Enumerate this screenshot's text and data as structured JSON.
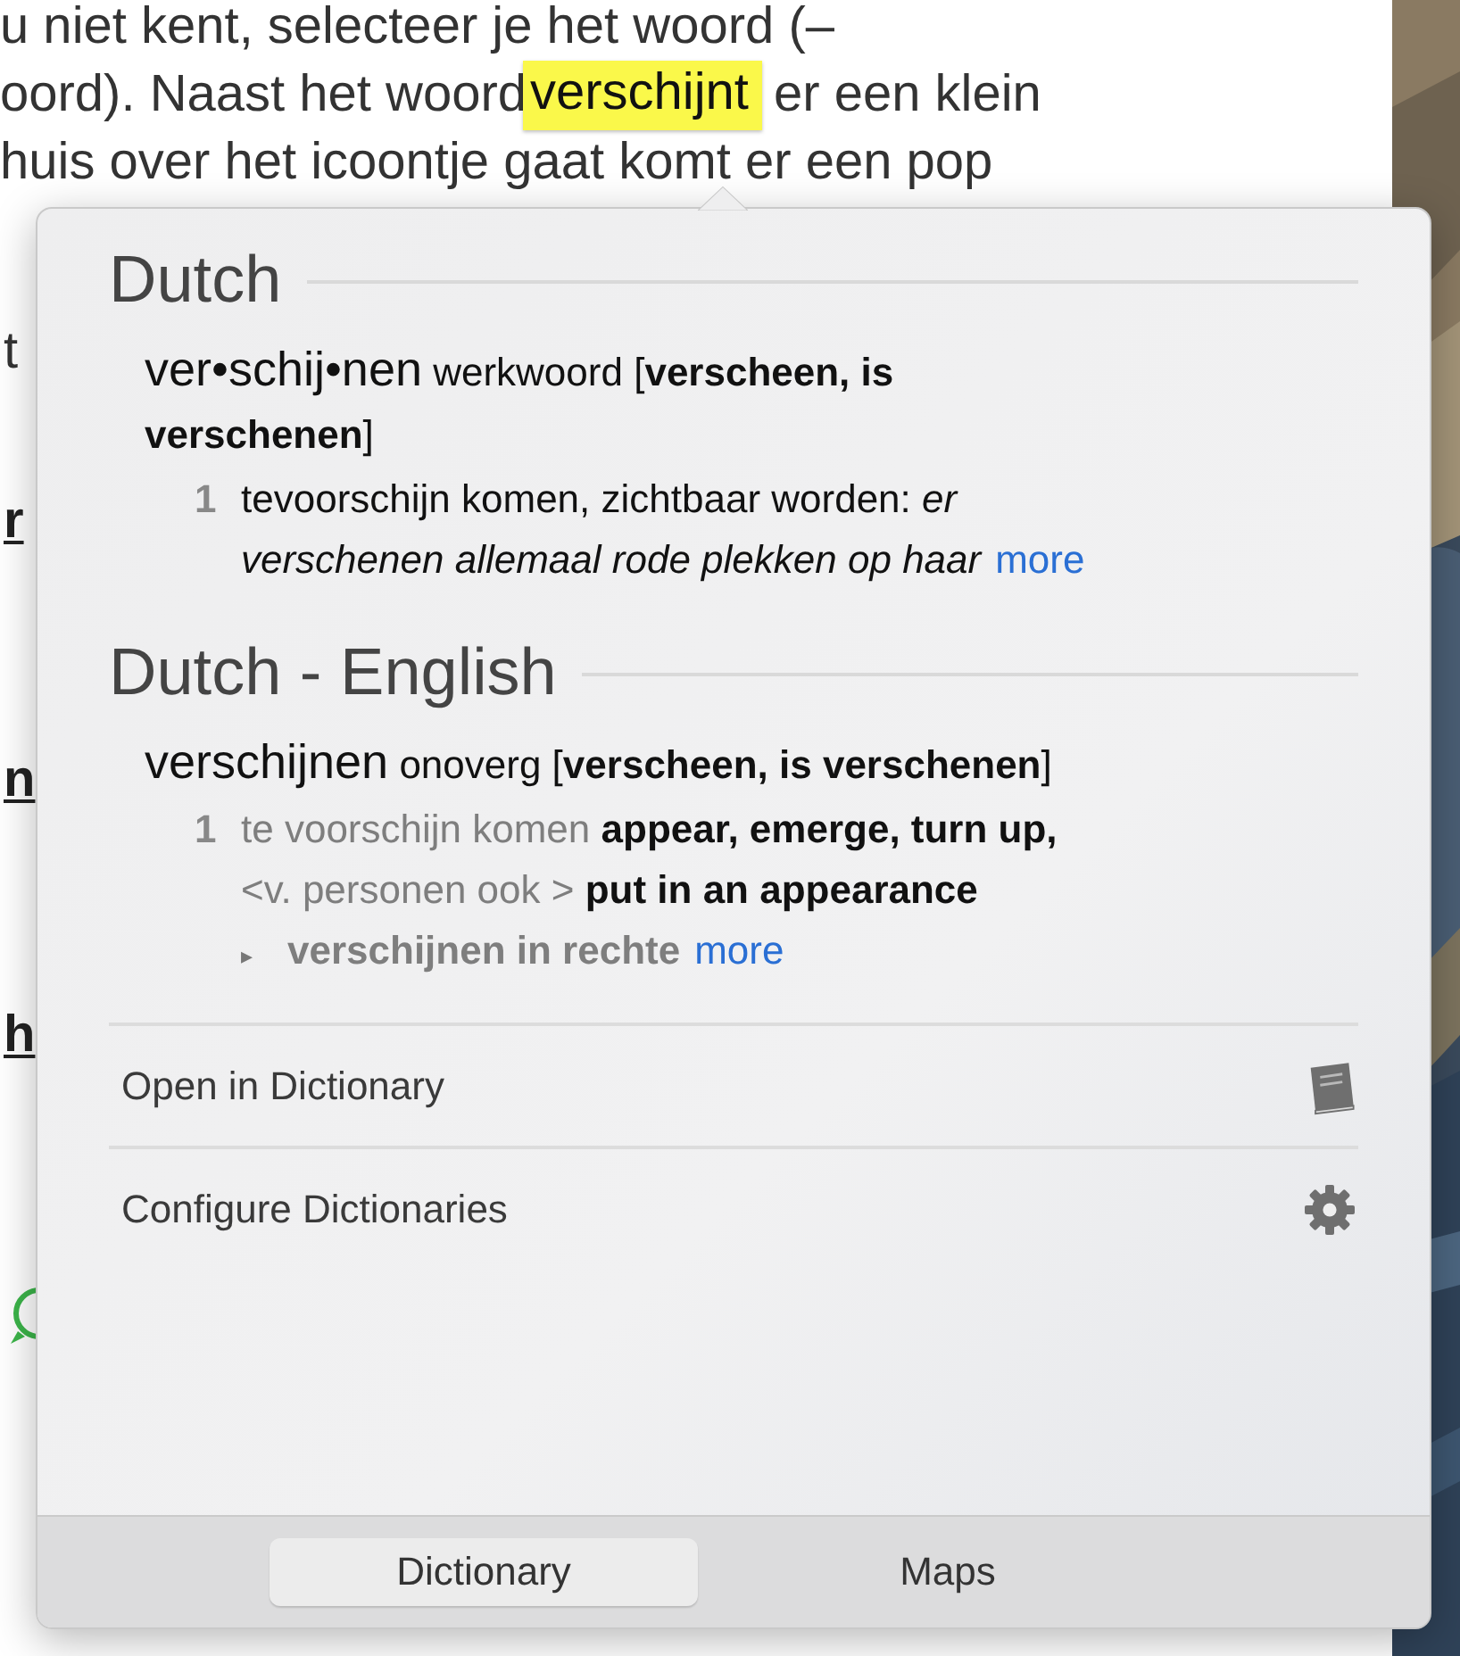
{
  "background_page": {
    "lines": [
      {
        "kind": "plain",
        "text": "u niet kent, selecteer je het woord (–"
      },
      {
        "kind": "highlight",
        "before": "oord). Naast het woord",
        "word": "verschijnt",
        "after": "er een klein"
      },
      {
        "kind": "plain",
        "text": "huis over het icoontje gaat komt er een pop"
      }
    ],
    "fragments": [
      {
        "kind": "plain",
        "text": "t"
      },
      {
        "kind": "link",
        "text": "r"
      },
      {
        "kind": "link",
        "text": "n"
      },
      {
        "kind": "link",
        "text": "h"
      },
      {
        "kind": "chat-icon"
      }
    ]
  },
  "popover": {
    "sections": [
      {
        "title": "Dutch",
        "headword": "ver•schij•nen",
        "grammar": "werkwoord [**verscheen, is verschenen**]",
        "senses": [
          {
            "kind": "definition",
            "number": "1",
            "lines": [
              "tevoorschijn komen, zichtbaar worden: *er*",
              "*verschenen allemaal rode plekken op haar*"
            ],
            "more": "more"
          }
        ]
      },
      {
        "title": "Dutch - English",
        "headword": "verschijnen",
        "grammar": "onoverg [**verscheen, is verschenen**]",
        "senses": [
          {
            "kind": "translation",
            "number": "1",
            "lines": [
              "te voorschijn komen **appear, emerge, turn up,**",
              "<v. personen ook > **put in an appearance**"
            ]
          },
          {
            "kind": "phrase",
            "marker": "▸",
            "lines": [
              "verschijnen in rechte"
            ],
            "more": "more"
          }
        ]
      }
    ],
    "actions": [
      {
        "kind": "book",
        "label": "Open in Dictionary"
      },
      {
        "kind": "gear",
        "label": "Configure Dictionaries"
      }
    ],
    "tabs": [
      {
        "label": "Dictionary",
        "selected": true
      },
      {
        "label": "Maps",
        "selected": false
      }
    ]
  }
}
